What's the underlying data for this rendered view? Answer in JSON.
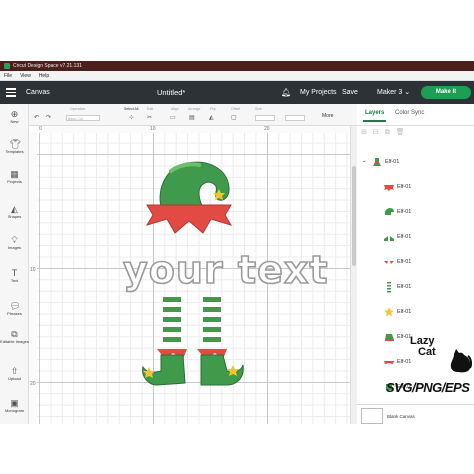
{
  "window": {
    "title": "Cricut Design Space  v7.21.131"
  },
  "menu": {
    "items": [
      "File",
      "View",
      "Help"
    ]
  },
  "header": {
    "section": "Canvas",
    "doc_title": "Untitled*",
    "my_projects": "My Projects",
    "save": "Save",
    "machine": "Maker 3",
    "make_it": "Make It"
  },
  "edit_toolbar": {
    "operation_label": "Operation",
    "operation_value": "Basic Cut",
    "select_all": "Select All",
    "edit": "Edit",
    "align": "Align",
    "arrange": "Arrange",
    "flip": "Flip",
    "offset": "Offset",
    "size": "Size",
    "more": "More"
  },
  "left_rail": {
    "items": [
      {
        "icon": "plus-icon",
        "label": "New"
      },
      {
        "icon": "shirt-icon",
        "label": "Templates"
      },
      {
        "icon": "projects-icon",
        "label": "Projects"
      },
      {
        "icon": "shapes-icon",
        "label": "Shapes"
      },
      {
        "icon": "image-icon",
        "label": "Images"
      },
      {
        "icon": "text-icon",
        "label": "Text"
      },
      {
        "icon": "phrases-icon",
        "label": "Phrases"
      },
      {
        "icon": "editable-image-icon",
        "label": "Editable Images"
      },
      {
        "icon": "upload-icon",
        "label": "Upload"
      },
      {
        "icon": "monogram-icon",
        "label": "Monogram"
      }
    ]
  },
  "rulers": {
    "h": [
      "0",
      "10",
      "20"
    ],
    "v": [
      "10",
      "20"
    ]
  },
  "canvas": {
    "text_element": "your text"
  },
  "right_panel": {
    "tabs": [
      "Layers",
      "Color Sync"
    ],
    "group": "Elf-01",
    "layers": [
      "Elf-01",
      "Elf-01",
      "Elf-01",
      "Elf-01",
      "Elf-01",
      "Elf-01",
      "Elf-01",
      "Elf-01",
      "Elf-01"
    ],
    "blank_canvas": "Blank Canvas"
  },
  "watermark": {
    "brand_line1": "Lazy",
    "brand_line2": "Cat",
    "formats": "SVG/PNG/EPS"
  },
  "colors": {
    "header_bg": "#2c3236",
    "title_bar": "#4a1f1c",
    "make_it": "#1c9f55",
    "active_tab": "#1a7d48",
    "elf_green": "#3f9a4c",
    "elf_red": "#e24b44",
    "star_yellow": "#f0c630"
  }
}
